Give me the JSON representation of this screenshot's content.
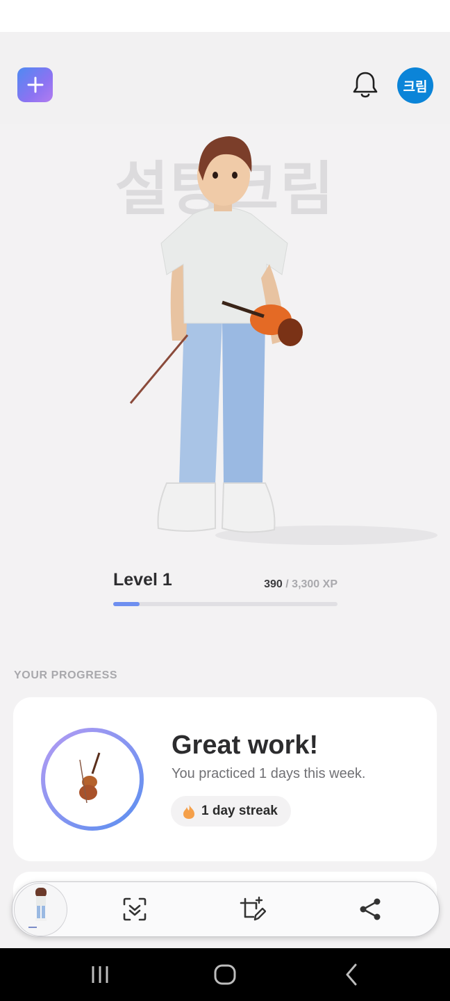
{
  "header": {
    "add_icon": "plus-icon",
    "bell_icon": "bell-icon",
    "avatar_text": "크림"
  },
  "hero": {
    "watermark": "설탕크림",
    "character": "3d-avatar-with-violin"
  },
  "level": {
    "label": "Level 1",
    "xp_current": "390",
    "xp_rest": " / 3,300 XP",
    "progress_fraction": 0.118
  },
  "progress": {
    "section_label": "YOUR PROGRESS",
    "title": "Great work!",
    "subtitle": "You practiced 1 days this week.",
    "streak": "1 day streak",
    "streak_icon": "flame-icon",
    "ring_icon": "violin-icon"
  },
  "toolbar": {
    "thumbnail": "screenshot-thumbnail",
    "tools": [
      "scan-text-icon",
      "edit-crop-icon",
      "share-icon"
    ]
  },
  "navbar": {
    "items": [
      "recent-apps-icon",
      "home-icon",
      "back-icon"
    ]
  },
  "colors": {
    "accent_blue": "#0b84d8",
    "gradient_start": "#4f8af2",
    "gradient_end": "#b27cf0",
    "xp_fill": "#6e8ff0",
    "streak_flame": "#f5a04a"
  }
}
